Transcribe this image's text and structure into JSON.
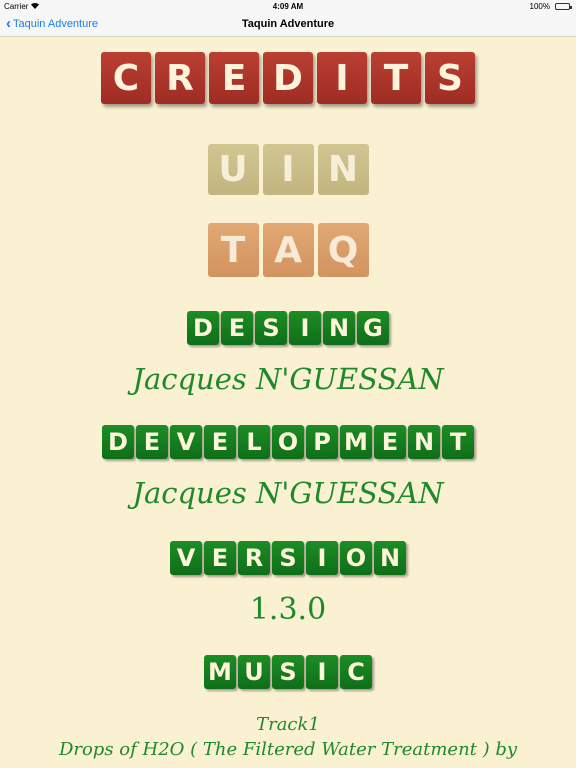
{
  "status_bar": {
    "carrier": "Carrier",
    "time": "4:09 AM",
    "battery": "100%"
  },
  "nav": {
    "back_label": "Taquin Adventure",
    "title": "Taquin Adventure"
  },
  "credits": {
    "title": "CREDITS",
    "logo_line1": "UIN",
    "logo_line2": "TAQ",
    "design_heading": "DESING",
    "design_name": "Jacques N'GUESSAN",
    "development_heading": "DEVELOPMENT",
    "development_name": "Jacques N'GUESSAN",
    "version_heading": "VERSION",
    "version_value": "1.3.0",
    "music_heading": "MUSIC",
    "music_track": "Track1",
    "music_line": "Drops of H2O ( The Filtered Water Treatment ) by"
  },
  "colors": {
    "background": "#faf0d2",
    "red_tile": "#b03a2e",
    "green_tile": "#17801f",
    "script_green": "#1f8a2a",
    "link_blue": "#1a7cf5"
  }
}
